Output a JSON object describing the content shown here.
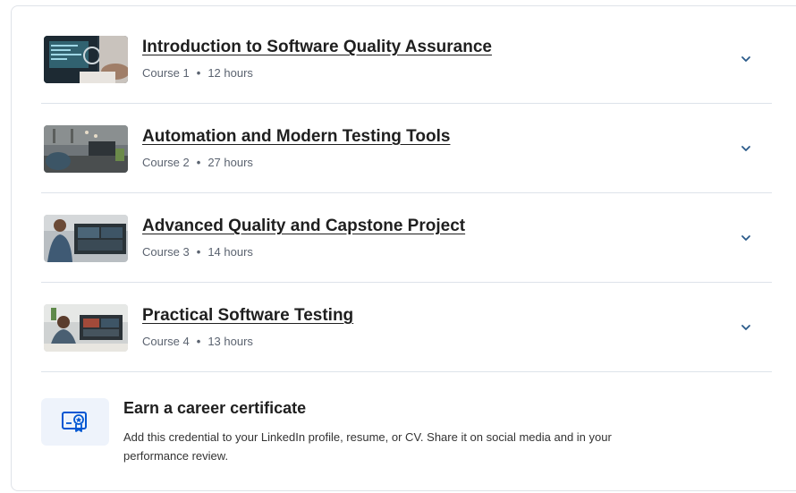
{
  "courses": [
    {
      "title": "Introduction to Software Quality Assurance",
      "course_label": "Course 1",
      "duration": "12 hours",
      "thumb_icon": "qa-workstation-photo"
    },
    {
      "title": "Automation and Modern Testing Tools",
      "course_label": "Course 2",
      "duration": "27 hours",
      "thumb_icon": "office-laptop-photo"
    },
    {
      "title": "Advanced Quality and Capstone Project",
      "course_label": "Course 3",
      "duration": "14 hours",
      "thumb_icon": "developer-monitors-photo"
    },
    {
      "title": "Practical Software Testing",
      "course_label": "Course 4",
      "duration": "13 hours",
      "thumb_icon": "tester-desk-photo"
    }
  ],
  "separator": "•",
  "certificate": {
    "title": "Earn a career certificate",
    "description": "Add this credential to your LinkedIn profile, resume, or CV. Share it on social media and in your performance review.",
    "icon": "certificate-icon"
  },
  "colors": {
    "accent": "#0056d2",
    "chevron": "#2a5a8a",
    "divider": "#dde3ea",
    "icon_bg": "#eef3fb"
  }
}
